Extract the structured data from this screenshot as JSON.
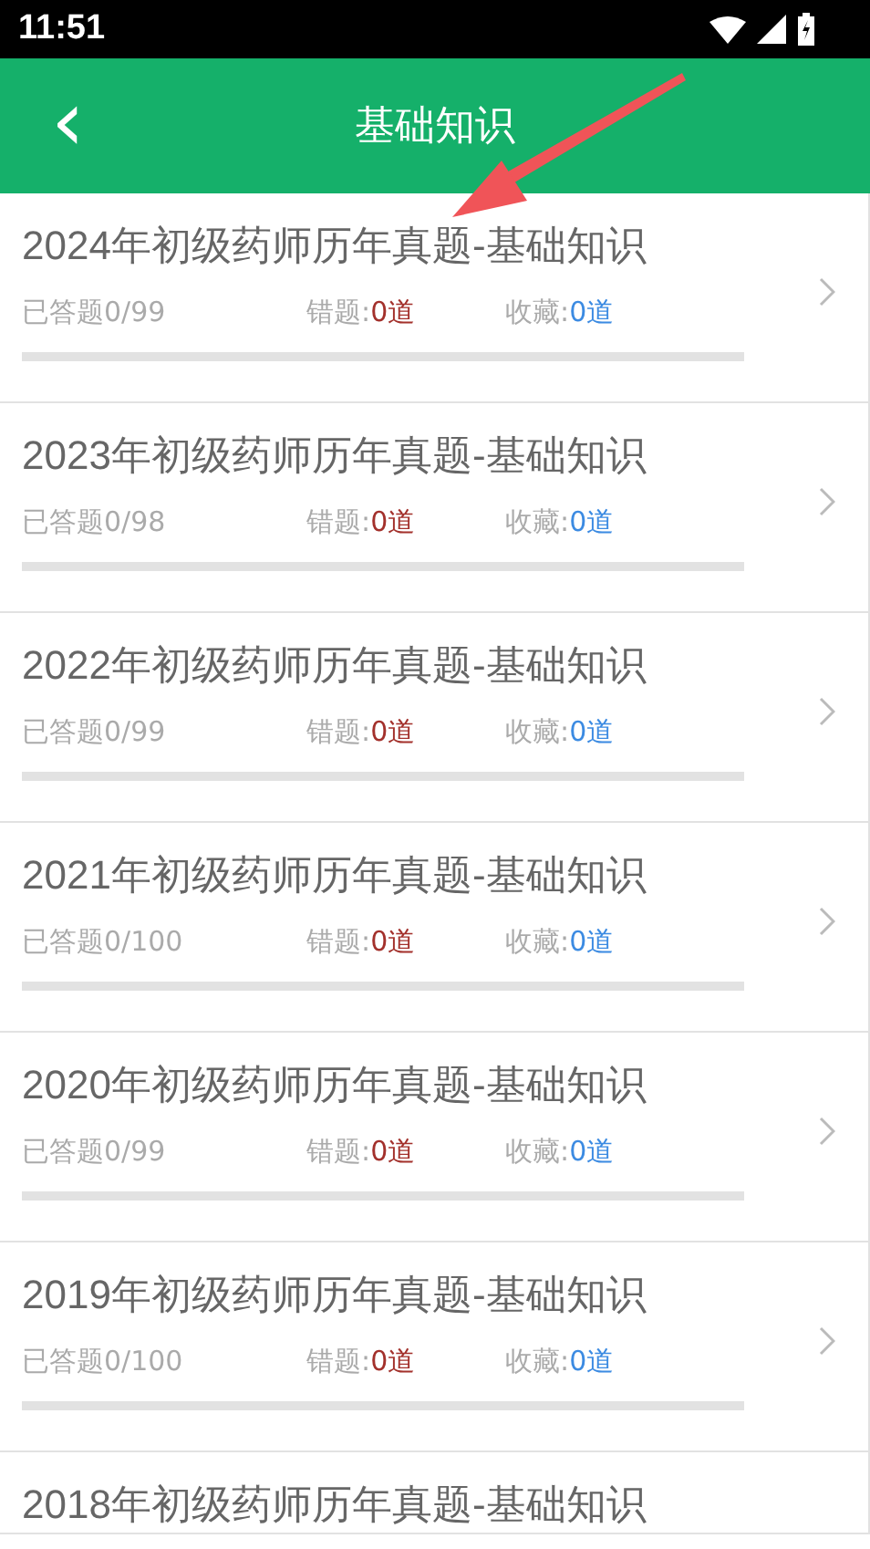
{
  "status_bar": {
    "time": "11:51"
  },
  "header": {
    "title": "基础知识",
    "back_icon": "‹"
  },
  "items": [
    {
      "kind": "full",
      "title": "2024年初级药师历年真题-基础知识",
      "answered": "已答题0/99",
      "wrong_label": "错题:",
      "wrong_value": "0道",
      "fav_label": "收藏:",
      "fav_value": "0道",
      "level": 0
    },
    {
      "kind": "full",
      "title": "2023年初级药师历年真题-基础知识",
      "answered": "已答题0/98",
      "wrong_label": "错题:",
      "wrong_value": "0道",
      "fav_label": "收藏:",
      "fav_value": "0道",
      "level": 0
    },
    {
      "kind": "full",
      "title": "2022年初级药师历年真题-基础知识",
      "answered": "已答题0/99",
      "wrong_label": "错题:",
      "wrong_value": "0道",
      "fav_label": "收藏:",
      "fav_value": "0道",
      "level": 0
    },
    {
      "kind": "full",
      "title": "2021年初级药师历年真题-基础知识",
      "answered": "已答题0/100",
      "wrong_label": "错题:",
      "wrong_value": "0道",
      "fav_label": "收藏:",
      "fav_value": "0道",
      "level": 0
    },
    {
      "kind": "full",
      "title": "2020年初级药师历年真题-基础知识",
      "answered": "已答题0/99",
      "wrong_label": "错题:",
      "wrong_value": "0道",
      "fav_label": "收藏:",
      "fav_value": "0道",
      "level": 0
    },
    {
      "kind": "full",
      "title": "2019年初级药师历年真题-基础知识",
      "answered": "已答题0/100",
      "wrong_label": "错题:",
      "wrong_value": "0道",
      "fav_label": "收藏:",
      "fav_value": "0道",
      "level": 0
    },
    {
      "kind": "partial",
      "title": "2018年初级药师历年真题-基础知识"
    }
  ]
}
